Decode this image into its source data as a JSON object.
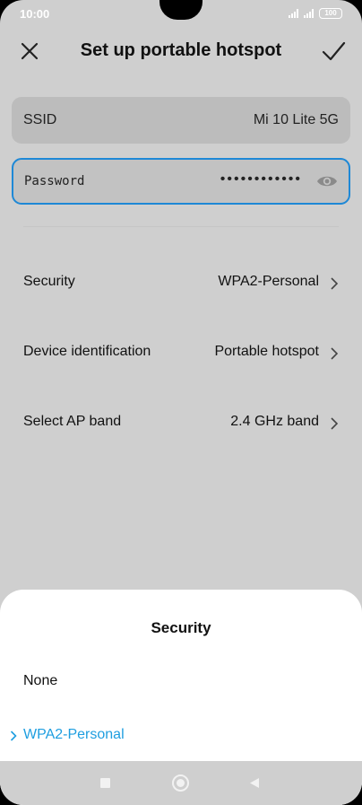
{
  "status_bar": {
    "time": "10:00",
    "battery": "100"
  },
  "header": {
    "title": "Set up portable hotspot"
  },
  "ssid_field": {
    "label": "SSID",
    "value": "Mi 10 Lite 5G"
  },
  "password_field": {
    "label": "Password",
    "masked_value": "••••••••••••"
  },
  "settings": [
    {
      "label": "Security",
      "value": "WPA2-Personal"
    },
    {
      "label": "Device identification",
      "value": "Portable hotspot"
    },
    {
      "label": "Select AP band",
      "value": "2.4 GHz band"
    }
  ],
  "sheet": {
    "title": "Security",
    "options": [
      {
        "label": "None",
        "selected": false
      },
      {
        "label": "WPA2-Personal",
        "selected": true
      }
    ]
  },
  "colors": {
    "accent": "#1e9ee0",
    "focus_border": "#1e88d6",
    "background": "#cfcfcf"
  },
  "icons": {
    "close": "close-icon",
    "confirm": "checkmark-icon",
    "password_visibility": "eye-icon",
    "row_chevron": "chevron-right-icon",
    "nav": [
      "recent-apps-icon",
      "home-icon",
      "back-icon"
    ]
  }
}
